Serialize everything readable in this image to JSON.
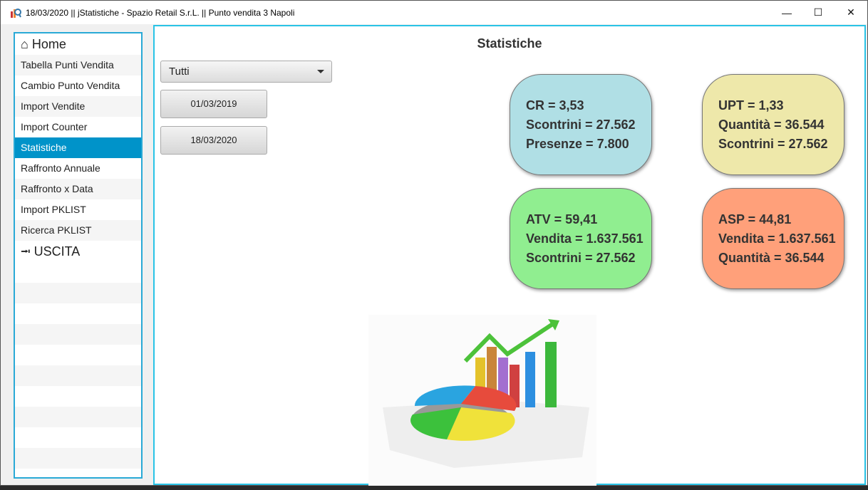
{
  "window": {
    "title": "18/03/2020 || jStatistiche - Spazio Retail S.r.L. || Punto vendita 3 Napoli",
    "minimize": "—",
    "maximize": "☐",
    "close": "✕"
  },
  "sidebar": {
    "home": "Home",
    "items": [
      "Tabella Punti Vendita",
      "Cambio Punto Vendita",
      "Import Vendite",
      "Import Counter",
      "Statistiche",
      "Raffronto Annuale",
      "Raffronto x Data",
      "Import PKLIST",
      "Ricerca PKLIST"
    ],
    "exit": "USCITA",
    "selected": "Statistiche"
  },
  "main": {
    "title": "Statistiche",
    "filter": "Tutti",
    "date_from": "01/03/2019",
    "date_to": "18/03/2020"
  },
  "cards": [
    {
      "color": "#b0dfe5",
      "lines": [
        "CR = 3,53",
        "Scontrini = 27.562",
        "Presenze = 7.800"
      ]
    },
    {
      "color": "#eee8aa",
      "lines": [
        "UPT = 1,33",
        "Quantità = 36.544",
        "Scontrini = 27.562"
      ]
    },
    {
      "color": "#90ee90",
      "lines": [
        "ATV = 59,41",
        "Vendita = 1.637.561",
        "Scontrini = 27.562"
      ]
    },
    {
      "color": "#ffa07a",
      "lines": [
        "ASP = 44,81",
        "Vendita = 1.637.561",
        "Quantità = 36.544"
      ]
    }
  ]
}
